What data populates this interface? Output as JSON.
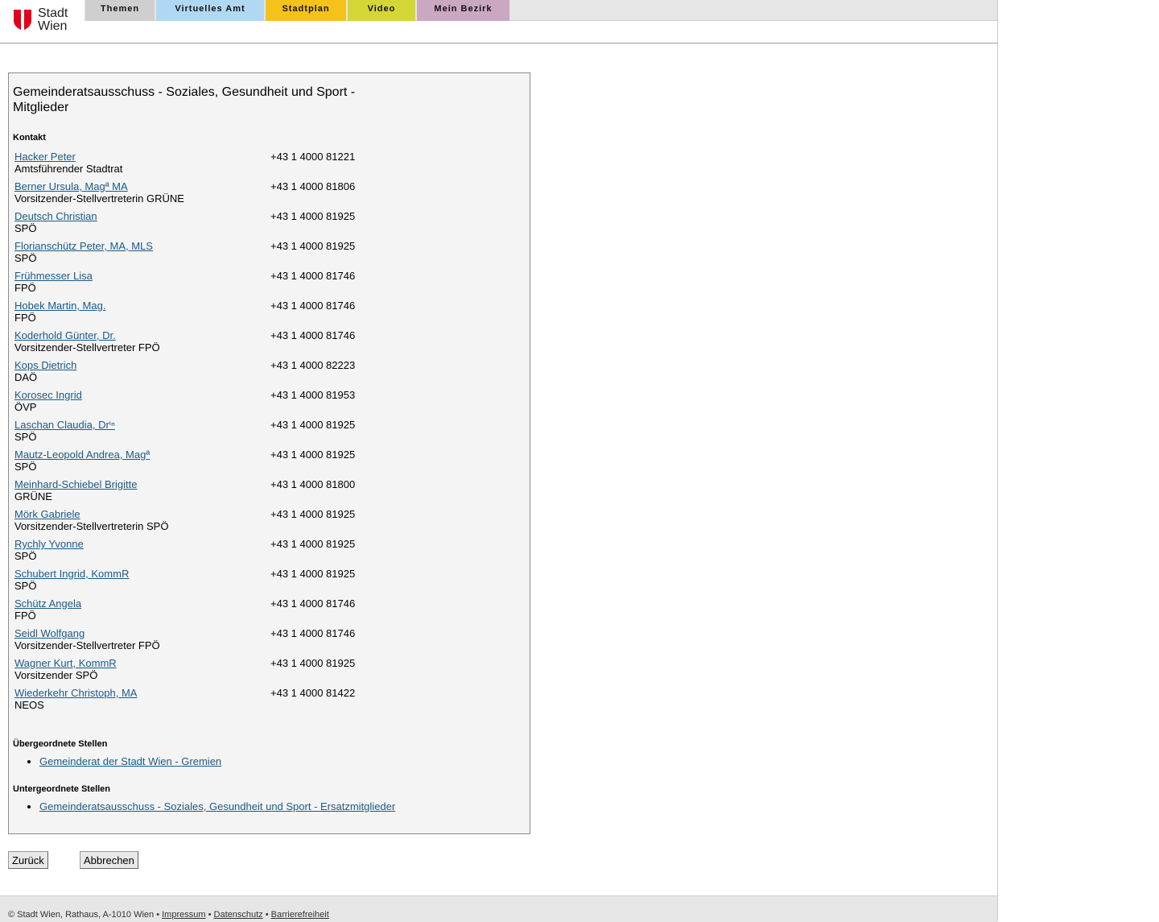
{
  "header": {
    "logo_line1": "Stadt",
    "logo_line2": "Wien",
    "tabs": [
      {
        "label": "Themen",
        "color": "#cfcfcf"
      },
      {
        "label": "Virtuelles Amt",
        "color": "#b0d8f2"
      },
      {
        "label": "Stadtplan",
        "color": "#f5c21b"
      },
      {
        "label": "Video",
        "color": "#d4d635"
      },
      {
        "label": "Mein Bezirk",
        "color": "#caa8c2"
      }
    ]
  },
  "main": {
    "title": "Gemeinderatsausschuss - Soziales, Gesundheit und Sport - Mitglieder",
    "contact_heading": "Kontakt",
    "members": [
      {
        "name": "Hacker Peter",
        "role": "Amtsführender Stadtrat",
        "phone": "+43 1 4000 81221"
      },
      {
        "name": "Berner Ursula, Magª MA",
        "role": "Vorsitzender-Stellvertreterin GRÜNE",
        "phone": "+43 1 4000 81806"
      },
      {
        "name": "Deutsch Christian",
        "role": "SPÖ",
        "phone": "+43 1 4000 81925"
      },
      {
        "name": "Florianschütz Peter, MA, MLS",
        "role": "SPÖ",
        "phone": "+43 1 4000 81925"
      },
      {
        "name": "Frühmesser Lisa",
        "role": "FPÖ",
        "phone": "+43 1 4000 81746"
      },
      {
        "name": "Hobek Martin, Mag.",
        "role": "FPÖ",
        "phone": "+43 1 4000 81746"
      },
      {
        "name": "Koderhold Günter, Dr.",
        "role": "Vorsitzender-Stellvertreter FPÖ",
        "phone": "+43 1 4000 81746"
      },
      {
        "name": "Kops Dietrich",
        "role": "DAÖ",
        "phone": "+43 1 4000 82223"
      },
      {
        "name": "Korosec Ingrid",
        "role": "ÖVP",
        "phone": "+43 1 4000 81953"
      },
      {
        "name": "Laschan Claudia, Drⁱⁿ",
        "role": "SPÖ",
        "phone": "+43 1 4000 81925"
      },
      {
        "name": "Mautz-Leopold Andrea, Magª",
        "role": "SPÖ",
        "phone": "+43 1 4000 81925"
      },
      {
        "name": "Meinhard-Schiebel Brigitte",
        "role": "GRÜNE",
        "phone": "+43 1 4000 81800"
      },
      {
        "name": "Mörk Gabriele",
        "role": "Vorsitzender-Stellvertreterin SPÖ",
        "phone": "+43 1 4000 81925"
      },
      {
        "name": "Rychly Yvonne",
        "role": "SPÖ",
        "phone": "+43 1 4000 81925"
      },
      {
        "name": "Schubert Ingrid, KommR",
        "role": "SPÖ",
        "phone": "+43 1 4000 81925"
      },
      {
        "name": "Schütz Angela",
        "role": "FPÖ",
        "phone": "+43 1 4000 81746"
      },
      {
        "name": "Seidl Wolfgang",
        "role": "Vorsitzender-Stellvertreter FPÖ",
        "phone": "+43 1 4000 81746"
      },
      {
        "name": "Wagner Kurt, KommR",
        "role": "Vorsitzender SPÖ",
        "phone": "+43 1 4000 81925"
      },
      {
        "name": "Wiederkehr Christoph, MA",
        "role": "NEOS",
        "phone": "+43 1 4000 81422"
      }
    ],
    "parent_heading": "Übergeordnete Stellen",
    "parent_links": [
      "Gemeinderat der Stadt Wien - Gremien"
    ],
    "child_heading": "Untergeordnete Stellen",
    "child_links": [
      "Gemeinderatsausschuss - Soziales, Gesundheit und Sport - Ersatzmitglieder"
    ]
  },
  "buttons": {
    "back": "Zurück",
    "cancel": "Abbrechen"
  },
  "footer": {
    "copyright": "© Stadt Wien, Rathaus, A-1010 Wien",
    "separator": "•",
    "links": [
      "Impressum",
      "Datenschutz",
      "Barrierefreiheit"
    ]
  }
}
